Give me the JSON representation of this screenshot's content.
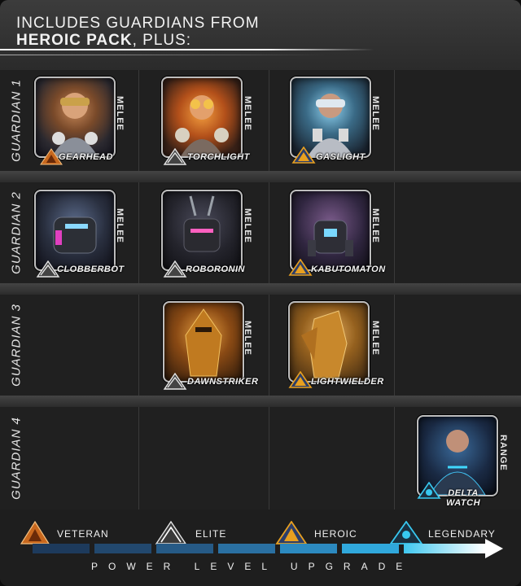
{
  "header": {
    "line1": "INCLUDES GUARDIANS FROM",
    "line2_bold": "HEROIC PACK",
    "line2_rest": ", PLUS:"
  },
  "rows": [
    {
      "label": "GUARDIAN 1"
    },
    {
      "label": "GUARDIAN 2"
    },
    {
      "label": "GUARDIAN 3"
    },
    {
      "label": "GUARDIAN 4"
    }
  ],
  "guardians": {
    "gearhead": {
      "name": "GEARHEAD",
      "role": "MELEE",
      "tier": "veteran"
    },
    "torchlight": {
      "name": "TORCHLIGHT",
      "role": "MELEE",
      "tier": "elite"
    },
    "gaslight": {
      "name": "GASLIGHT",
      "role": "MELEE",
      "tier": "heroic"
    },
    "clobberbot": {
      "name": "CLOBBERBOT",
      "role": "MELEE",
      "tier": "elite"
    },
    "roboronin": {
      "name": "ROBORONIN",
      "role": "MELEE",
      "tier": "elite"
    },
    "kabutomaton": {
      "name": "KABUTOMATON",
      "role": "MELEE",
      "tier": "heroic"
    },
    "dawnstriker": {
      "name": "DAWNSTRIKER",
      "role": "MELEE",
      "tier": "elite"
    },
    "lightwielder": {
      "name": "LIGHTWIELDER",
      "role": "MELEE",
      "tier": "heroic"
    },
    "deltawatch": {
      "name1": "DELTA",
      "name2": "WATCH",
      "role": "RANGE",
      "tier": "legendary"
    }
  },
  "legend": {
    "veteran": "VETERAN",
    "elite": "ELITE",
    "heroic": "HEROIC",
    "legendary": "LEGENDARY",
    "caption": "POWER LEVEL UPGRADE"
  },
  "colors": {
    "veteran": "#c8681e",
    "elite": "#d8d8d8",
    "heroic": "#e8a020",
    "legendary": "#38c8f0",
    "bar_start": "#1d3a5c",
    "bar_end": "#4fd8ff"
  }
}
